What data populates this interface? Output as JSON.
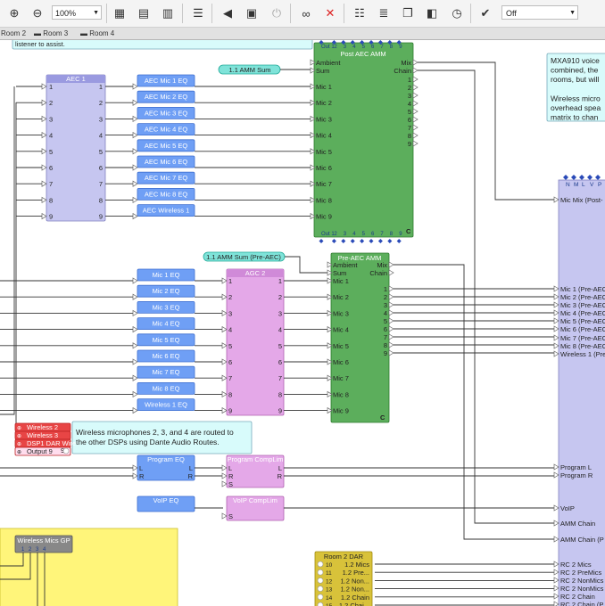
{
  "toolbar": {
    "zoom_value": "100%",
    "mode_value": "Off",
    "buttons": [
      "zoom-in-icon",
      "zoom-out-icon",
      "grid-icon",
      "table-icon",
      "layout-icon",
      "document-icon",
      "speaker-icon",
      "device-icon",
      "power-icon",
      "binoculars-icon",
      "disconnect-icon",
      "notes-icon",
      "list-icon",
      "window-icon",
      "panel-icon",
      "clock-icon",
      "check-icon"
    ]
  },
  "tabs": [
    "Room 2",
    "Room 3",
    "Room 4"
  ],
  "notes": {
    "top_left": "listener to assist.",
    "wireless": [
      "Wireless microphones 2, 3, and 4 are routed to",
      "the other DSPs using Dante Audio Routes."
    ],
    "mxa": [
      "MXA910 voice",
      "combined, the",
      "rooms, but will",
      "",
      "Wireless micro",
      "overhead spea",
      "matrix to chan"
    ]
  },
  "aec1": {
    "title": "AEC 1",
    "pins": [
      "1",
      "2",
      "3",
      "4",
      "5",
      "6",
      "7",
      "8",
      "9"
    ]
  },
  "aec_eqs": [
    "AEC Mic 1 EQ",
    "AEC Mic 2 EQ",
    "AEC Mic 3 EQ",
    "AEC Mic 4 EQ",
    "AEC Mic 5 EQ",
    "AEC Mic 6 EQ",
    "AEC Mic 7 EQ",
    "AEC Mic 8 EQ",
    "AEC Wireless 1"
  ],
  "amm_sum": "1.1 AMM Sum",
  "amm_sum_pre": "1.1 AMM Sum (Pre-AEC)",
  "post_amm": {
    "title": "Post AEC AMM",
    "top_pins": [
      "Out 1",
      "2",
      "3",
      "4",
      "5",
      "6",
      "7",
      "8",
      "9"
    ],
    "inputs": [
      "Ambient",
      "Sum",
      "Mic 1",
      "Mic 2",
      "Mic 3",
      "Mic 4",
      "Mic 5",
      "Mic 6",
      "Mic 7",
      "Mic 8",
      "Mic 9"
    ],
    "outputs": [
      "Mix",
      "Chain",
      "1",
      "2",
      "3",
      "4",
      "5",
      "6",
      "7",
      "8",
      "9"
    ],
    "badge": "C"
  },
  "mic_eqs": [
    "Mic 1 EQ",
    "Mic 2 EQ",
    "Mic 3 EQ",
    "Mic 4 EQ",
    "Mic 5 EQ",
    "Mic 6 EQ",
    "Mic 7 EQ",
    "Mic 8 EQ",
    "Wireless 1 EQ"
  ],
  "agc": {
    "title": "AGC 2",
    "pins": [
      "1",
      "2",
      "3",
      "4",
      "5",
      "6",
      "7",
      "8",
      "9"
    ]
  },
  "pre_amm": {
    "title": "Pre-AEC AMM",
    "inputs": [
      "Ambient",
      "Sum",
      "Mic 1",
      "Mic 2",
      "Mic 3",
      "Mic 4",
      "Mic 5",
      "Mic 6",
      "Mic 7",
      "Mic 8",
      "Mic 9"
    ],
    "outputs": [
      "Mix",
      "Chain",
      "1",
      "2",
      "3",
      "4",
      "5",
      "6",
      "7",
      "8",
      "9"
    ],
    "badge": "C"
  },
  "wireless_block": {
    "rows": [
      "Wireless 2",
      "Wireless 3",
      "DSP1 DAR Wire",
      "Output 9"
    ],
    "pin": "9"
  },
  "program_eq": {
    "title": "Program EQ",
    "pins": [
      "L",
      "R"
    ]
  },
  "program_comp": {
    "title": "Program CompLim",
    "pins": [
      "L",
      "R",
      "S"
    ]
  },
  "voip_eq": {
    "title": "VoIP EQ"
  },
  "voip_comp": {
    "title": "VoIP CompLim",
    "pins": [
      "S"
    ]
  },
  "wireless_gp": {
    "title": "Wireless Mics GP",
    "pins": [
      "1",
      "2",
      "3",
      "4"
    ]
  },
  "room2_dar": {
    "title": "Room 2 DAR",
    "nums": [
      "10",
      "11",
      "12",
      "13",
      "14",
      "15"
    ],
    "labels": [
      "1.2 Mics",
      "1.2 Pre...",
      "1.2 Non...",
      "1.2 Non...",
      "1.2 Chain",
      "1.2 Chai..."
    ]
  },
  "matrix": {
    "header": [
      "N",
      "M",
      "L",
      "V",
      "P"
    ],
    "inputs": [
      "Mic Mix (Post-",
      "Mic 1 (Pre-AEC",
      "Mic 2 (Pre-AEC",
      "Mic 3 (Pre-AEC",
      "Mic 4 (Pre-AEC",
      "Mic 5 (Pre-AEC",
      "Mic 6 (Pre-AEC",
      "Mic 7 (Pre-AEC",
      "Mic 8 (Pre-AEC",
      "Wireless 1 (Pre",
      "Program L",
      "Program R",
      "VoIP",
      "AMM Chain",
      "AMM Chain (P",
      "RC 2 Mics",
      "RC 2 PreMics",
      "RC 2 NonMics",
      "RC 2 NonMics",
      "RC 2 Chain",
      "RC 2 Chain (P"
    ]
  },
  "colors": {
    "blue_eq": "#6f9ff5",
    "aec_body": "#c6c6f0",
    "green": "#5cae5c",
    "pink": "#e4a8e8",
    "cyan": "#7fe3d9",
    "yellow": "#fff57a",
    "note": "#d8fbfb",
    "red": "#e84545"
  }
}
